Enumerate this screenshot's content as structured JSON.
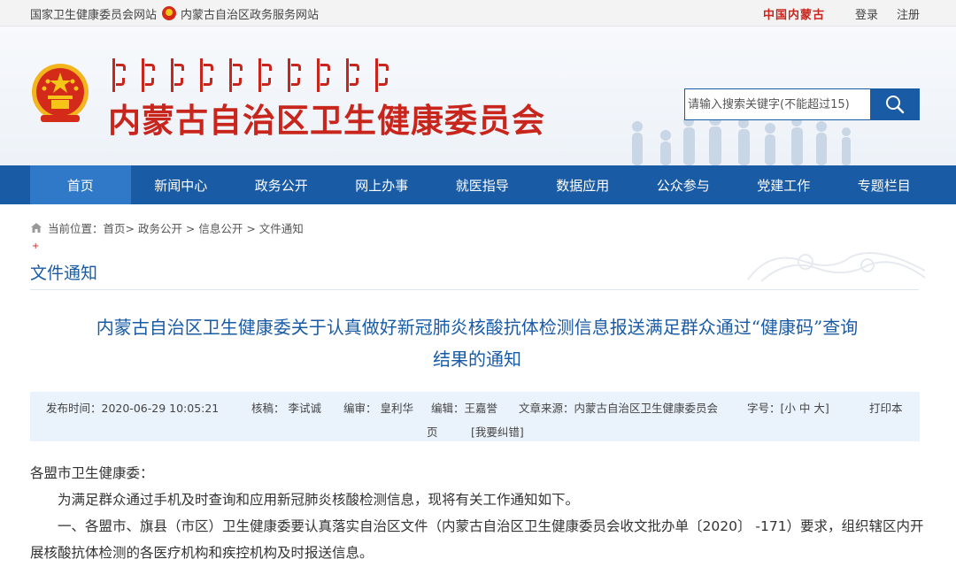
{
  "topbar": {
    "link_nhc": "国家卫生健康委员会网站",
    "link_gov": "内蒙古自治区政务服务网站",
    "brand": "中国内蒙古",
    "login": "登录",
    "register": "注册"
  },
  "header": {
    "site_title": "内蒙古自治区卫生健康委员会",
    "search_placeholder": "请输入搜索关键字(不能超过15)"
  },
  "nav": {
    "items": [
      "首页",
      "新闻中心",
      "政务公开",
      "网上办事",
      "就医指导",
      "数据应用",
      "公众参与",
      "党建工作",
      "专题栏目"
    ]
  },
  "breadcrumb": {
    "label": "当前位置：",
    "path": "首页> 政务公开 > 信息公开 > 文件通知"
  },
  "section": {
    "plus": "+",
    "title": "文件通知"
  },
  "article": {
    "title_line1": "内蒙古自治区卫生健康委关于认真做好新冠肺炎核酸抗体检测信息报送满足群众通过“健康码”查询",
    "title_line2": "结果的通知",
    "meta": {
      "publish_time": "发布时间：2020-06-29 10:05:21",
      "reviewer": "核稿：  李试诚",
      "editor": "编审：  皇利华",
      "compiler": "编辑：王嘉誉",
      "source": "文章来源：内蒙古自治区卫生健康委员会",
      "font_size": "字号：[小 中 大]",
      "print_a": "打印本",
      "print_b": "页",
      "report_error": "[我要纠错]"
    },
    "salutation": "各盟市卫生健康委：",
    "para1": "为满足群众通过手机及时查询和应用新冠肺炎核酸检测信息，现将有关工作通知如下。",
    "para2": "一、各盟市、旗县（市区）卫生健康委要认真落实自治区文件（内蒙古自治区卫生健康委员会收文批办单〔2020〕 -171）要求，组织辖区内开展核酸抗体检测的各医疗机构和疾控机构及时报送信息。"
  }
}
